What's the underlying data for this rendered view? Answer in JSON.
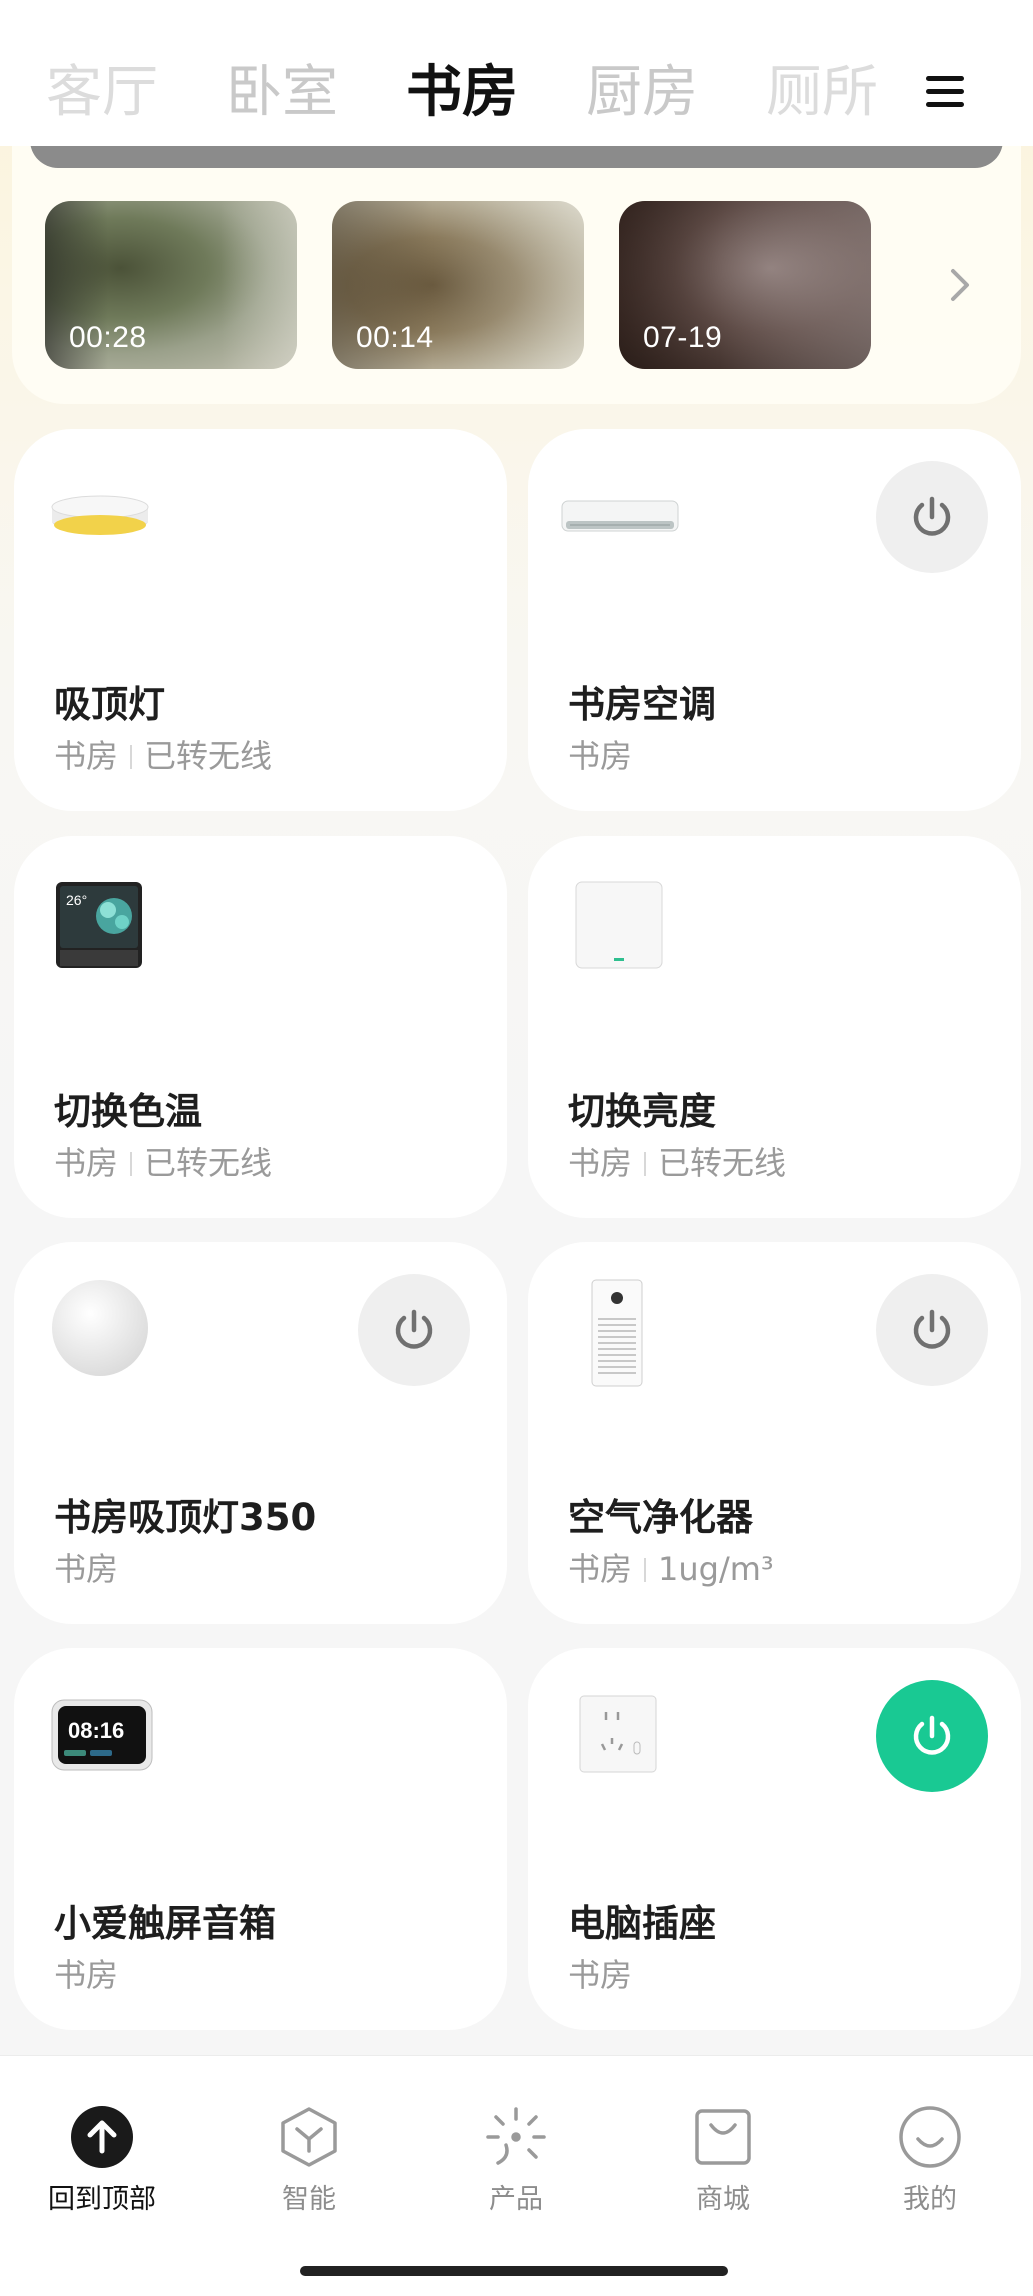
{
  "tabs": [
    "客厅",
    "卧室",
    "书房",
    "厨房",
    "厕所"
  ],
  "active_tab": "书房",
  "camera": {
    "clips": [
      {
        "label": "00:28",
        "tone": "#6f7a5a"
      },
      {
        "label": "00:14",
        "tone": "#8a7a5c"
      },
      {
        "label": "07-19",
        "tone": "#5d4a45"
      }
    ]
  },
  "devices": [
    {
      "name": "吸顶灯",
      "room": "书房",
      "status": "已转无线",
      "icon": "ceiling-light-icon",
      "power": null
    },
    {
      "name": "书房空调",
      "room": "书房",
      "status": "",
      "icon": "air-conditioner-icon",
      "power": "off"
    },
    {
      "name": "切换色温",
      "room": "书房",
      "status": "已转无线",
      "icon": "smart-panel-icon",
      "power": null
    },
    {
      "name": "切换亮度",
      "room": "书房",
      "status": "已转无线",
      "icon": "wall-switch-icon",
      "power": null
    },
    {
      "name": "书房吸顶灯350",
      "room": "书房",
      "status": "",
      "icon": "round-ceiling-light-icon",
      "power": "off"
    },
    {
      "name": "空气净化器",
      "room": "书房",
      "status": "1ug/m³",
      "icon": "air-purifier-icon",
      "power": "off"
    },
    {
      "name": "小爱触屏音箱",
      "room": "书房",
      "status": "",
      "icon": "touchscreen-speaker-icon",
      "power": null
    },
    {
      "name": "电脑插座",
      "room": "书房",
      "status": "",
      "icon": "power-socket-icon",
      "power": "on"
    }
  ],
  "smart_panel": {
    "temp": "26°"
  },
  "speaker": {
    "clock": "08:16"
  },
  "bottom_nav": [
    {
      "label": "回到顶部",
      "icon": "back-to-top-icon",
      "active": true
    },
    {
      "label": "智能",
      "icon": "smart-cube-icon",
      "active": false
    },
    {
      "label": "产品",
      "icon": "product-sparkle-icon",
      "active": false
    },
    {
      "label": "商城",
      "icon": "shopping-bag-icon",
      "active": false
    },
    {
      "label": "我的",
      "icon": "profile-smile-icon",
      "active": false
    }
  ],
  "colors": {
    "accent_on": "#19c993",
    "power_off_bg": "#efefef"
  }
}
